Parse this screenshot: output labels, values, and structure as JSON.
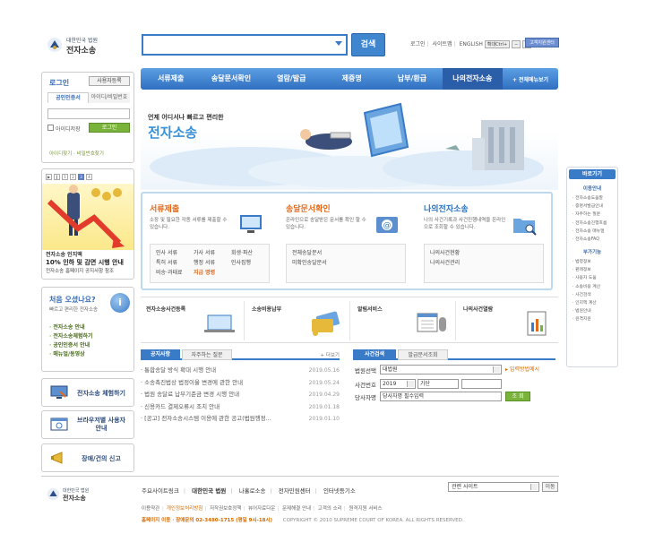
{
  "header": {
    "logo_small": "대한민국 법원",
    "logo_title": "전자소송",
    "search_placeholder": "",
    "search_button": "검색",
    "links": [
      "로그인",
      "사이트맵",
      "ENGLISH"
    ],
    "font_btn": "확대Ctrl+",
    "customer_button": "고객지원센터"
  },
  "nav": {
    "items": [
      "서류제출",
      "송달문서확인",
      "열람/발급",
      "제증명",
      "납부/환급",
      "나의전자소송"
    ],
    "active_index": 5,
    "more": "+ 전체메뉴보기"
  },
  "login": {
    "title": "로그인",
    "register": "사용자등록",
    "tab_cert": "공인인증서",
    "tab_id": "아이디/비밀번호",
    "save_id": "아이디저장",
    "login_button": "로그인",
    "find": "아이디찾기 · 비밀번호찾기"
  },
  "promo": {
    "pages": [
      "1",
      "2",
      "3",
      "4"
    ],
    "active_page": 3,
    "line1": "전자소송 인지액",
    "line2": "10% 인하 및 감면 시행 안내",
    "line3": "전자소송 홈페이지 공지사항 참조"
  },
  "first_visit": {
    "title": "처음 오셨나요?",
    "subtitle": "빠르고 편리한 전자소송",
    "items": [
      "전자소송 안내",
      "전자소송체험하기",
      "공인인증서 안내",
      "매뉴얼/동영상"
    ]
  },
  "side_services": [
    "전자소송 체험하기",
    "브라우저별 사용자안내",
    "장애/건의 신고"
  ],
  "hero": {
    "tagline": "언제 어디서나 빠르고 편리한",
    "title": "전자소송"
  },
  "cards": [
    {
      "title": "서류제출",
      "desc": "소장 및 필요한 각종 서류를 제출할 수 있습니다.",
      "rows": [
        [
          "민사 서류",
          "가사 서류",
          "회생·파산"
        ],
        [
          "특허 서류",
          "행정 서류",
          "민사집행"
        ],
        [
          "비송·과태료",
          "지급 명령",
          ""
        ]
      ],
      "highlight": "지급 명령"
    },
    {
      "title": "송달문서확인",
      "desc": "온라인으로 송달받은 문서를 확인 할 수 있습니다.",
      "rows": [
        [
          "전체송달문서"
        ],
        [
          "미확인송달문서"
        ]
      ]
    },
    {
      "title": "나의전자소송",
      "desc": "나의 사건기록과 사건진행내역을 온라인으로 조회할 수 있습니다.",
      "rows": [
        [
          "나의사건현황"
        ],
        [
          "나의사건관리"
        ]
      ]
    }
  ],
  "services": [
    "전자소송사건등록",
    "소송비용납부",
    "알림서비스",
    "나의사건열람"
  ],
  "notice": {
    "tab_notice": "공지사항",
    "tab_faq": "자주하는 질문",
    "more": "+ 더보기",
    "items": [
      {
        "title": "통합송달 방식 확대 시행 안내",
        "date": "2019.05.16"
      },
      {
        "title": "소송촉진법상 법정이율 변경에 관한 안내",
        "date": "2019.05.24"
      },
      {
        "title": "법원 송달료 납부기준금 변경 시행 안내",
        "date": "2019.04.29"
      },
      {
        "title": "신용카드 결제오류시 조치 안내",
        "date": "2019.01.18"
      },
      {
        "title": "[공고] 전자소송시스템 이용에 관한 공고(법원행정...",
        "date": "2019.01.10"
      }
    ]
  },
  "case_search": {
    "tab_case": "사건검색",
    "tab_doc": "발급문서조회",
    "court_label": "법원선택",
    "court_value": "대법원",
    "guide": "▸ 입력방법예시",
    "number_label": "사건번호",
    "year": "2019",
    "type": "가단",
    "party_label": "당사자명",
    "party_value": "당사자명 필수입력",
    "query_button": "조 회"
  },
  "quick": {
    "title": "바로가기",
    "sec1": "이용안내",
    "list1": [
      "전자소송도움말",
      "증명서발급안내",
      "자주하는 질문",
      "전자소송진행흐름",
      "전자소송 매뉴얼",
      "전자소송FAQ"
    ],
    "sec2": "부가기능",
    "list2": [
      "법령정보",
      "판례정보",
      "사용자 도움",
      "소송비용 계산",
      "사건검색",
      "인지액 계산",
      "법원안내",
      "원격지원"
    ]
  },
  "footer": {
    "logo_small": "대한민국 법원",
    "logo_title": "전자소송",
    "links": [
      "주요사이트링크",
      "대한민국 법원",
      "나홀로소송",
      "전자민원센터",
      "인터넷등기소"
    ],
    "related": "관련 사이트",
    "go": "이동",
    "menu": [
      "이용약관",
      "개인정보처리방침",
      "저작권보호정책",
      "뷰어자료다운",
      "문제해결 안내",
      "고객의 소리",
      "원격지원 서비스"
    ],
    "contact": "홈페이지 이용 · 장애문의 02-3480-1715 (평일 9시-18시)",
    "copyright": "COPYRIGHT © 2010 SUPREME COURT OF KOREA. ALL RIGHTS RESERVED."
  },
  "colors": {
    "brand_blue": "#3a7bc8",
    "accent_orange": "#e26a1c",
    "green": "#79b33a"
  }
}
